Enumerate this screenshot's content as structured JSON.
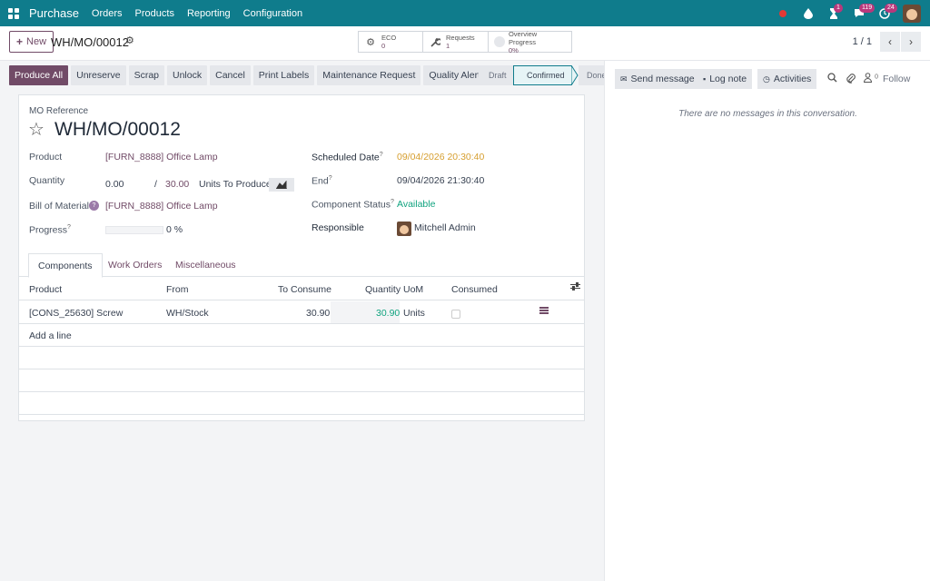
{
  "navbar": {
    "brand": "Purchase",
    "menus": [
      "Orders",
      "Products",
      "Reporting",
      "Configuration"
    ],
    "badges": {
      "activity": "1",
      "messages": "119",
      "clock": "24"
    }
  },
  "control_panel": {
    "new_label": "New",
    "record_title": "WH/MO/00012",
    "stats": {
      "eco_label": "ECO",
      "eco_value": "0",
      "requests_label": "Requests",
      "requests_value": "1",
      "overview_label": "Overview Progress",
      "overview_value": "0%"
    },
    "pager": "1 / 1"
  },
  "statusbar": {
    "buttons": [
      "Produce All",
      "Unreserve",
      "Scrap",
      "Unlock",
      "Cancel",
      "Print Labels",
      "Maintenance Request",
      "Quality Alert"
    ],
    "stages": [
      "Draft",
      "Confirmed",
      "Done"
    ],
    "current_stage": "Confirmed"
  },
  "form": {
    "ref_label": "MO Reference",
    "ref_value": "WH/MO/00012",
    "product_label": "Product",
    "product_value": "[FURN_8888] Office Lamp",
    "quantity_label": "Quantity",
    "quantity_produced": "0.00",
    "quantity_sep": "/",
    "quantity_total": "30.00",
    "quantity_suffix": "Units To Produce",
    "bom_label": "Bill of Material",
    "bom_help": "?",
    "bom_value": "[FURN_8888] Office Lamp",
    "progress_label": "Progress",
    "progress_value": "0 %",
    "progress_fraction": 0,
    "scheduled_label": "Scheduled Date",
    "scheduled_value": "09/04/2026 20:30:40",
    "end_label": "End",
    "end_value": "09/04/2026 21:30:40",
    "component_status_label": "Component Status",
    "component_status_value": "Available",
    "responsible_label": "Responsible",
    "responsible_value": "Mitchell Admin",
    "help_mark": "?"
  },
  "tabs": [
    "Components",
    "Work Orders",
    "Miscellaneous"
  ],
  "table": {
    "headers": [
      "Product",
      "From",
      "To Consume",
      "Quantity",
      "UoM",
      "Consumed"
    ],
    "rows": [
      {
        "product": "[CONS_25630] Screw",
        "from": "WH/Stock",
        "to_consume": "30.90",
        "quantity": "30.90",
        "uom": "Units"
      }
    ],
    "add_line": "Add a line"
  },
  "chatter": {
    "send_message": "Send message",
    "log_note": "Log note",
    "activities": "Activities",
    "follower_count": "0",
    "follow": "Follow",
    "empty": "There are no messages in this conversation."
  },
  "colors": {
    "navbar": "#0f7c8c",
    "primary": "#714b67",
    "success": "#10a37f",
    "warning": "#d69e2e"
  }
}
